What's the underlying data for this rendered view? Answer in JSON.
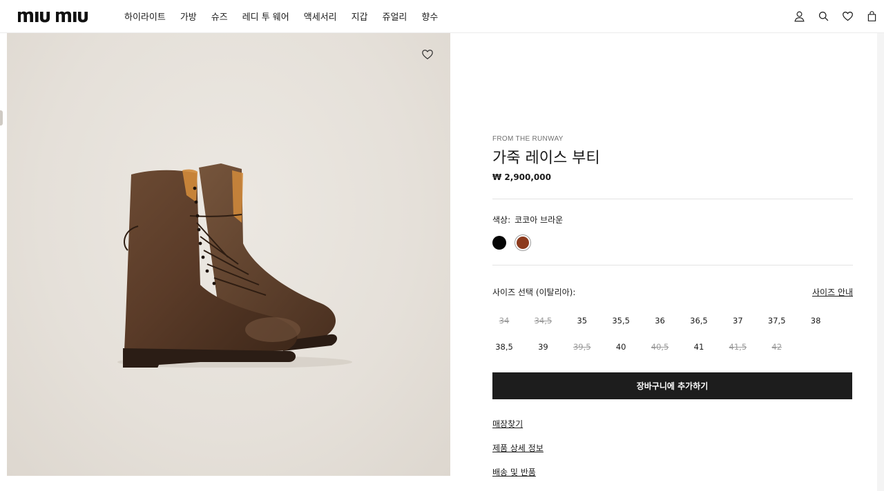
{
  "brand": {
    "logo_text": "miu miu"
  },
  "nav": {
    "items": [
      "하이라이트",
      "가방",
      "슈즈",
      "레디 투 웨어",
      "액세서리",
      "지갑",
      "쥬얼리",
      "향수"
    ]
  },
  "header_icons": [
    "account-icon",
    "search-icon",
    "wishlist-icon",
    "bag-icon"
  ],
  "product": {
    "eyebrow": "FROM THE RUNWAY",
    "name": "가죽 레이스 부티",
    "price": "₩ 2,900,000",
    "color_label": "색상:",
    "color_value": "코코아 브라운",
    "colors": [
      {
        "name": "black",
        "hex": "#050505"
      },
      {
        "name": "cocoa-brown",
        "hex": "#8c3a1d",
        "selected": true
      }
    ],
    "size_label": "사이즈 선택 (이탈리아):",
    "size_guide": "사이즈 안내",
    "sizes": [
      {
        "label": "34",
        "available": false
      },
      {
        "label": "34,5",
        "available": false
      },
      {
        "label": "35",
        "available": true
      },
      {
        "label": "35,5",
        "available": true
      },
      {
        "label": "36",
        "available": true
      },
      {
        "label": "36,5",
        "available": true
      },
      {
        "label": "37",
        "available": true
      },
      {
        "label": "37,5",
        "available": true
      },
      {
        "label": "38",
        "available": true
      },
      {
        "label": "38,5",
        "available": true
      },
      {
        "label": "39",
        "available": true
      },
      {
        "label": "39,5",
        "available": false
      },
      {
        "label": "40",
        "available": true
      },
      {
        "label": "40,5",
        "available": false
      },
      {
        "label": "41",
        "available": true
      },
      {
        "label": "41,5",
        "available": false
      },
      {
        "label": "42",
        "available": false
      }
    ],
    "add_to_cart": "장바구니에 추가하기",
    "links": [
      "매장찾기",
      "제품 상세 정보",
      "배송 및 반품"
    ]
  }
}
